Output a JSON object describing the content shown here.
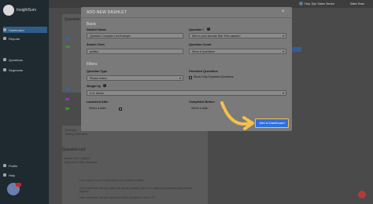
{
  "app": {
    "brand": "InsightSurv",
    "nav": [
      {
        "label": "Dashboard",
        "active": true
      },
      {
        "label": "Reports",
        "active": false
      }
    ],
    "nav2": [
      {
        "label": "Questions"
      },
      {
        "label": "Segments"
      }
    ],
    "nav_bottom": [
      {
        "label": "Profile"
      },
      {
        "label": "Help"
      }
    ],
    "user": {
      "name": "Hey, Dyn Sales Senior",
      "sub": "",
      "team": "Sales Team"
    }
  },
  "background": {
    "panel1_title": "Question",
    "panel2_title": "Question List",
    "search_line": "Search Term \"politics\"",
    "search_sub": "Yelps and Profile statement",
    "rows": [
      "How many of your friends share your political beliefs?",
      "How concerned are you right now about protests in the U.S. targeting politicians and political figures?",
      "How concerned are you about the effect of politics in the U.S.?"
    ],
    "summary_label": "Summary",
    "summary_sub": "Testing statements"
  },
  "modal": {
    "title": "ADD NEW DASHLET",
    "close": "×",
    "basic_label": "Basic",
    "filters_label": "Filters",
    "dashlet_name": {
      "label": "Dashlet Name",
      "value": "Question Compare List Example"
    },
    "question": {
      "label": "Question",
      "value": "Who is your favorite Star Trek captain?"
    },
    "search_term": {
      "label": "Search Term",
      "value": "politics"
    },
    "question_count": {
      "label": "Question Count",
      "value": "Show 8 Questions"
    },
    "question_type": {
      "label": "Question Type",
      "value": "Please select..."
    },
    "favorited_questions": {
      "label": "Favorited Questions",
      "checkbox_label": "Show Only Favorited Questions"
    },
    "weight_by": {
      "label": "Weight by",
      "value": "U.S. Adults"
    },
    "launched_after": {
      "label": "Launched After",
      "placeholder": "Select a date..."
    },
    "completed_before": {
      "label": "Completed Before",
      "placeholder": "Select a date..."
    },
    "add_button": "Add to Dashboard"
  },
  "colors": {
    "accent": "#2e6fdc",
    "highlight": "#f3c14b",
    "modal_bg": "#7a7a7a"
  }
}
